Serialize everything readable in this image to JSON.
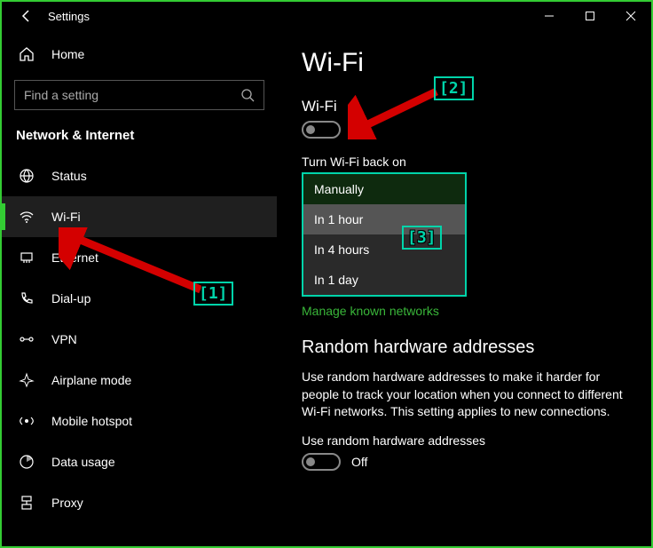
{
  "window": {
    "title": "Settings"
  },
  "sidebar": {
    "home": "Home",
    "search_placeholder": "Find a setting",
    "category": "Network & Internet",
    "items": [
      {
        "label": "Status"
      },
      {
        "label": "Wi-Fi"
      },
      {
        "label": "Ethernet"
      },
      {
        "label": "Dial-up"
      },
      {
        "label": "VPN"
      },
      {
        "label": "Airplane mode"
      },
      {
        "label": "Mobile hotspot"
      },
      {
        "label": "Data usage"
      },
      {
        "label": "Proxy"
      }
    ]
  },
  "content": {
    "page_title": "Wi-Fi",
    "wifi_section": "Wi-Fi",
    "wifi_state": "Off",
    "turn_back_label": "Turn Wi-Fi back on",
    "options": [
      "Manually",
      "In 1 hour",
      "In 4 hours",
      "In 1 day"
    ],
    "known_networks": "Manage known networks",
    "random_heading": "Random hardware addresses",
    "random_body": "Use random hardware addresses to make it harder for people to track your location when you connect to different Wi-Fi networks. This setting applies to new connections.",
    "random_toggle_label": "Use random hardware addresses",
    "random_state": "Off"
  },
  "annotations": {
    "a1": "[1]",
    "a2": "[2]",
    "a3": "[3]"
  }
}
